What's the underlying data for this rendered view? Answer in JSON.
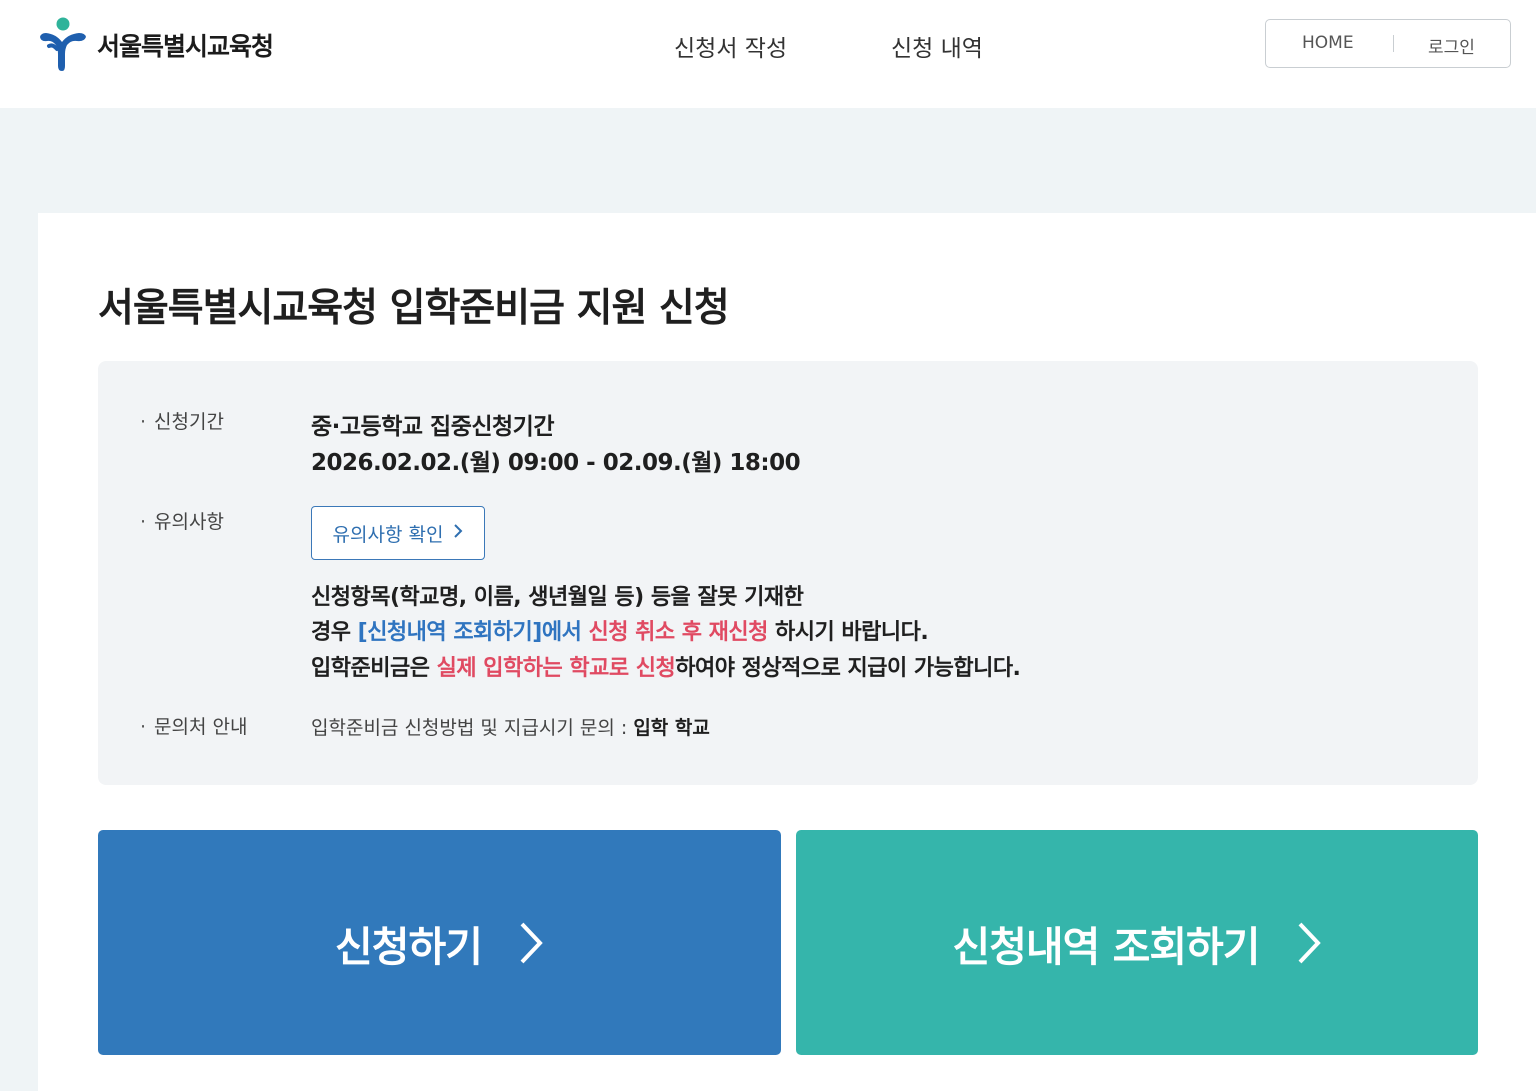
{
  "header": {
    "logo_text": "서울특별시교육청",
    "nav": [
      {
        "label": "신청서 작성"
      },
      {
        "label": "신청 내역"
      }
    ],
    "util": {
      "home": "HOME",
      "login": "로그인"
    }
  },
  "main": {
    "title": "서울특별시교육청 입학준비금 지원 신청",
    "info": {
      "period_label": "신청기간",
      "period_line1": "중·고등학교 집중신청기간",
      "period_line2": "2026.02.02.(월) 09:00 - 02.09.(월) 18:00",
      "notice_label": "유의사항",
      "notice_button": "유의사항 확인",
      "notice_l1": "신청항목(학교명, 이름, 생년월일 등) 등을 잘못 기재한",
      "notice_l2_a": "경우 ",
      "notice_l2_b": "[신청내역 조회하기]에서",
      "notice_l2_c": " 신청 취소 후 재신청",
      "notice_l2_d": " 하시기 바랍니다.",
      "notice_l3_a": "입학준비금은 ",
      "notice_l3_b": "실제 입학하는 학교로 신청",
      "notice_l3_c": "하여야 정상적으로 지급이 가능합니다.",
      "contact_label": "문의처 안내",
      "contact_text": "입학준비금 신청방법 및 지급시기 문의 : ",
      "contact_bold": "입학 학교"
    },
    "buttons": {
      "apply": "신청하기",
      "query": "신청내역 조회하기"
    }
  },
  "colors": {
    "apply_button": "#3179bb",
    "query_button": "#35b5ab",
    "highlight_blue": "#2f74c0",
    "highlight_red": "#e04a62",
    "logo_blue": "#1f5fae",
    "logo_green": "#2fb39a"
  },
  "icons": {
    "logo": "seoul-education-logo-icon",
    "chevron": "chevron-right-icon"
  }
}
